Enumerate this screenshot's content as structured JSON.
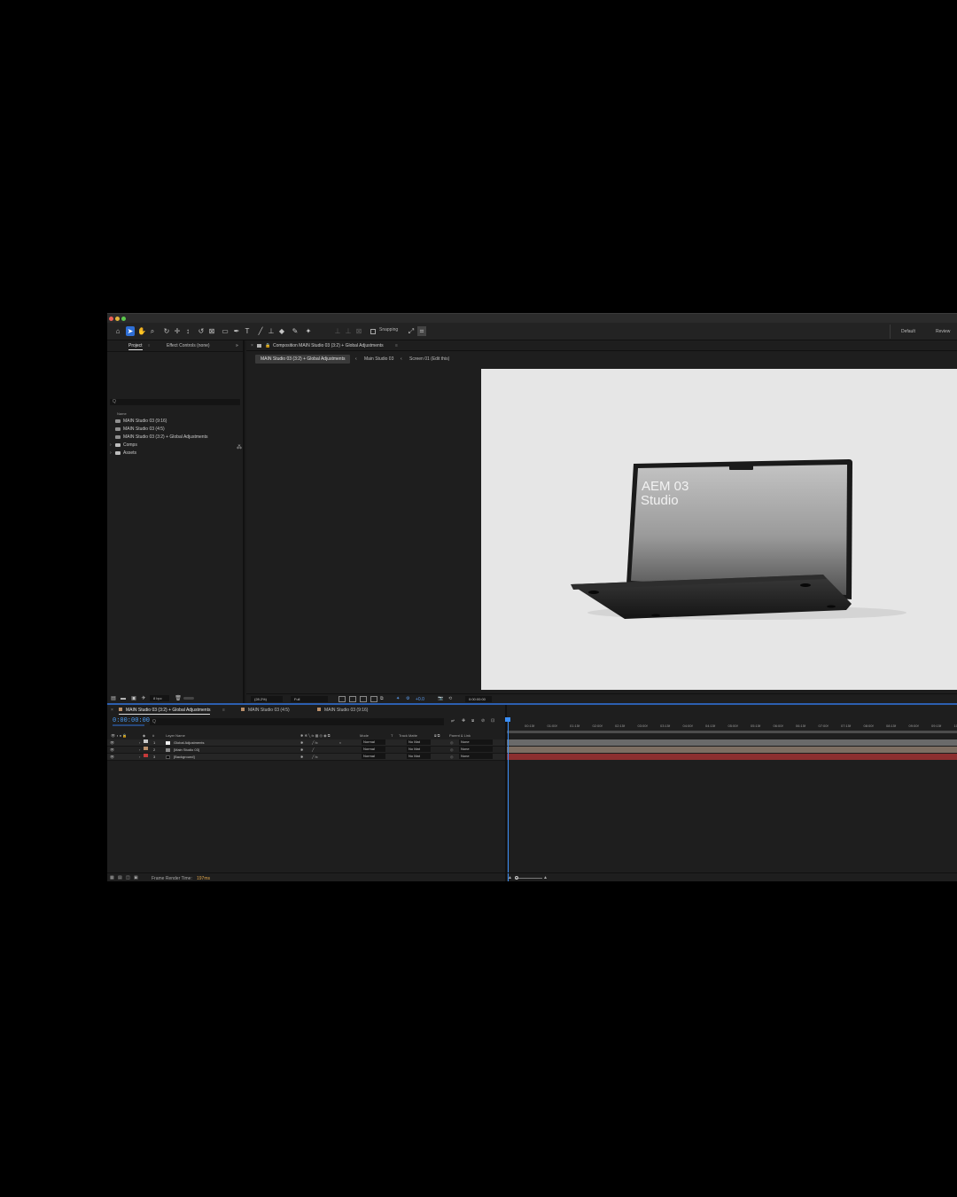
{
  "toolbar": {
    "snapping_label": "Snapping",
    "workspaces": [
      "Default",
      "Review"
    ]
  },
  "project_panel": {
    "tabs": [
      "Project",
      "Effect Controls (none)"
    ],
    "search_placeholder": "Q",
    "column_name": "Name",
    "items": [
      {
        "type": "comp",
        "label": "MAIN Studio 03 (9:16)"
      },
      {
        "type": "comp",
        "label": "MAIN Studio 03 (4:5)"
      },
      {
        "type": "comp",
        "label": "MAIN Studio 03 (3:2) + Global Adjustments"
      },
      {
        "type": "folder",
        "label": "Comps"
      },
      {
        "type": "folder",
        "label": "Assets"
      }
    ],
    "bpc": "8 bpc"
  },
  "composition": {
    "title": "Composition MAIN Studio 03 (3:2) + Global Adjustments",
    "breadcrumbs": [
      "MAIN Studio 03 (3:2) + Global Adjustments",
      "Main Studio 03",
      "Screen 01 (Edit this)"
    ],
    "screen_text_line1": "AEM 03",
    "screen_text_line2": "Studio",
    "zoom": "(28.2%)",
    "resolution": "Full",
    "exposure": "+0.0",
    "timecode": "0:00:00:00"
  },
  "timeline": {
    "tabs": [
      "MAIN Studio 03 (3:2) + Global Adjustments",
      "MAIN Studio 03 (4:5)",
      "MAIN Studio 03 (9:16)"
    ],
    "current_time": "0:00:00:00",
    "search_placeholder": "Q",
    "columns": {
      "num": "#",
      "layer_name": "Layer Name",
      "mode": "Mode",
      "t": "T",
      "track_matte": "Track Matte",
      "parent": "Parent & Link"
    },
    "layers": [
      {
        "num": "1",
        "name": "Global Adjustments",
        "mode": "Normal",
        "matte": "No Mat",
        "parent": "None",
        "color": "#c8c8c8"
      },
      {
        "num": "2",
        "name": "[Main Studio 03]",
        "mode": "Normal",
        "matte": "No Mat",
        "parent": "None",
        "color": "#b98f6a"
      },
      {
        "num": "3",
        "name": "[Background]",
        "mode": "Normal",
        "matte": "No Mat",
        "parent": "None",
        "color": "#c43a3a"
      }
    ],
    "ruler_ticks": [
      "00:15f",
      "01:00f",
      "01:15f",
      "02:00f",
      "02:15f",
      "03:00f",
      "03:15f",
      "04:00f",
      "04:15f",
      "05:00f",
      "05:15f",
      "06:00f",
      "06:15f",
      "07:00f",
      "07:15f",
      "08:00f",
      "08:15f",
      "09:00f",
      "09:15f",
      "10:0"
    ],
    "bar_colors": [
      "#6a6a6a",
      "#7d6e62",
      "#8c2f2f"
    ],
    "frame_render_label": "Frame Render Time:",
    "frame_render_value": "197ms"
  }
}
